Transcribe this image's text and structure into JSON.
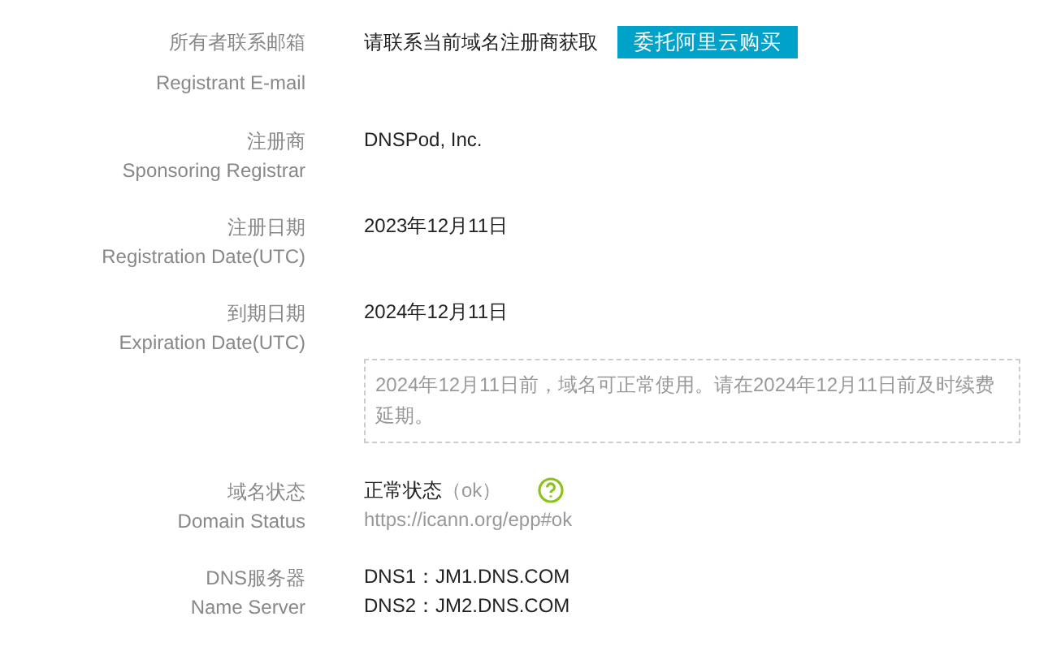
{
  "fields": [
    {
      "kind": "email",
      "label_cn": "所有者联系邮箱",
      "label_en": "Registrant E-mail",
      "value": "请联系当前域名注册商获取",
      "button": "委托阿里云购买"
    },
    {
      "kind": "text",
      "label_cn": "注册商",
      "label_en": "Sponsoring Registrar",
      "lines": [
        "DNSPod, Inc."
      ]
    },
    {
      "kind": "text",
      "label_cn": "注册日期",
      "label_en": "Registration Date(UTC)",
      "lines": [
        "2023年12月11日"
      ]
    },
    {
      "kind": "expiry",
      "label_cn": "到期日期",
      "label_en": "Expiration Date(UTC)",
      "value": "2024年12月11日",
      "note": "2024年12月11日前，域名可正常使用。请在2024年12月11日前及时续费延期。"
    },
    {
      "kind": "status",
      "label_cn": "域名状态",
      "label_en": "Domain Status",
      "value": "正常状态",
      "code": "（ok）",
      "link": "https://icann.org/epp#ok"
    },
    {
      "kind": "text",
      "label_cn": "DNS服务器",
      "label_en": "Name Server",
      "lines": [
        "DNS1：JM1.DNS.COM",
        "DNS2：JM2.DNS.COM"
      ]
    }
  ]
}
